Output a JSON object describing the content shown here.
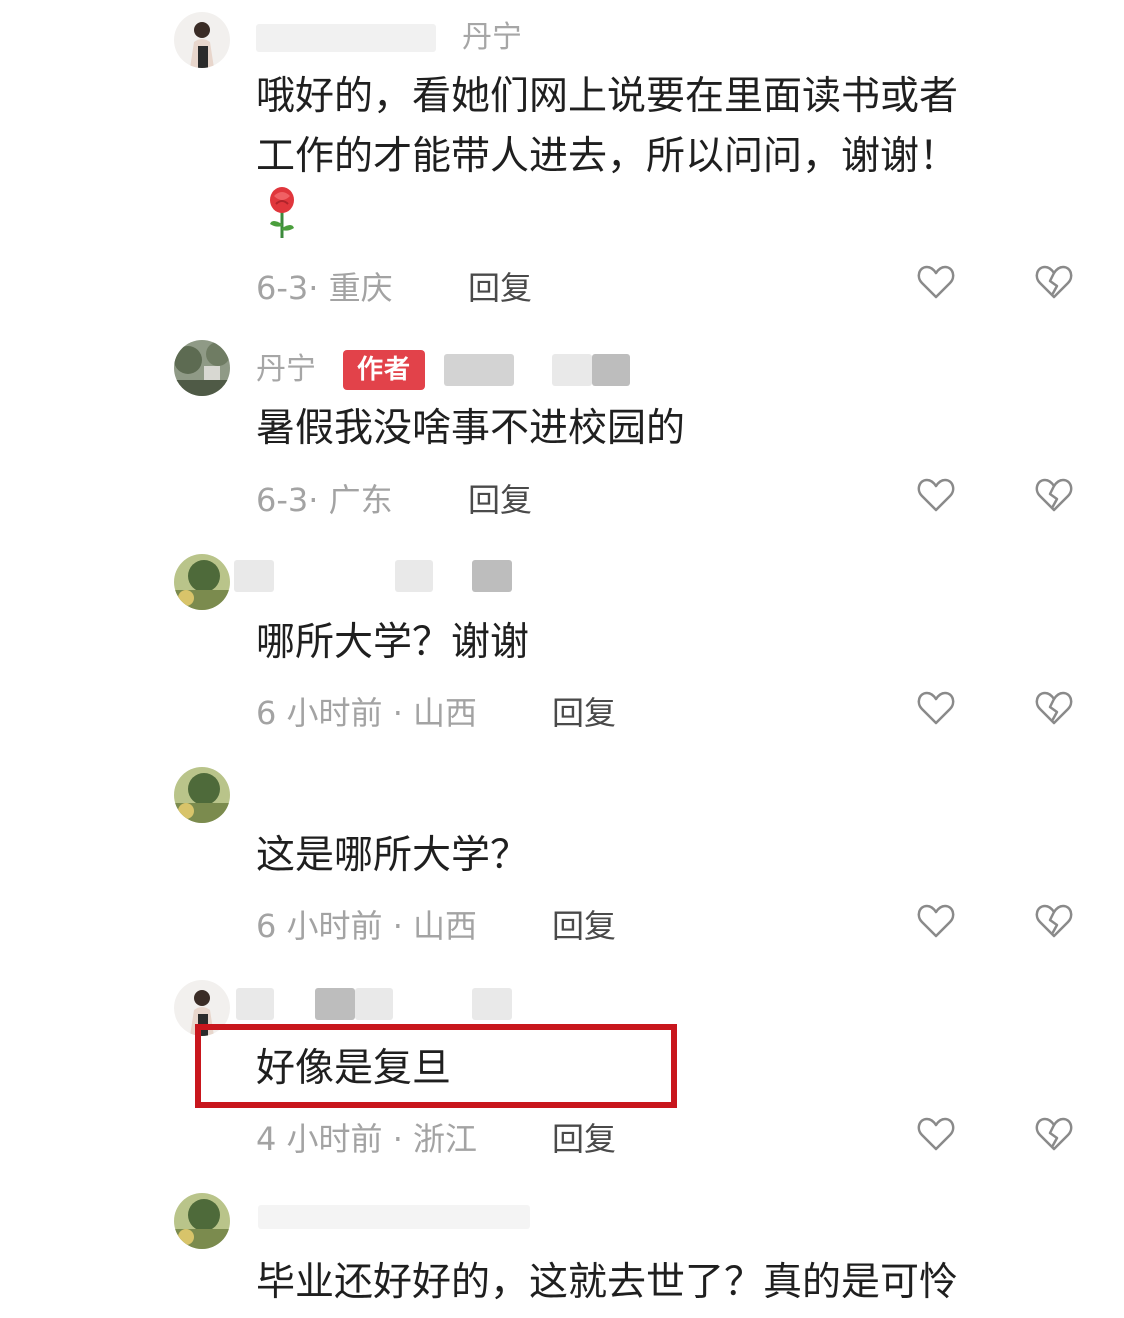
{
  "comments": [
    {
      "username": "丹宁",
      "text_lines": [
        "哦好的，看她们网上说要在里面读书或者",
        "工作的才能带人进去，所以问问，谢谢！"
      ],
      "emoji": "rose-icon",
      "meta": "6-3· 重庆",
      "reply_label": "回复"
    },
    {
      "username": "丹宁",
      "badge": "作者",
      "text": "暑假我没啥事不进校园的",
      "meta": "6-3· 广东",
      "reply_label": "回复"
    },
    {
      "text": "哪所大学？谢谢",
      "meta": "6 小时前 · 山西",
      "reply_label": "回复"
    },
    {
      "text": "这是哪所大学？",
      "meta": "6 小时前 · 山西",
      "reply_label": "回复"
    },
    {
      "text": "好像是复旦",
      "meta": "4 小时前 · 浙江",
      "reply_label": "回复"
    },
    {
      "text": "毕业还好好的，这就去世了？真的是可怜"
    }
  ],
  "colors": {
    "highlight_border": "#c8161d",
    "author_badge_bg": "#e2424a",
    "text": "#1f1f1f",
    "meta": "#a3a3a3"
  },
  "icons": {
    "like": "heart-outline-icon",
    "dislike": "broken-heart-icon"
  }
}
